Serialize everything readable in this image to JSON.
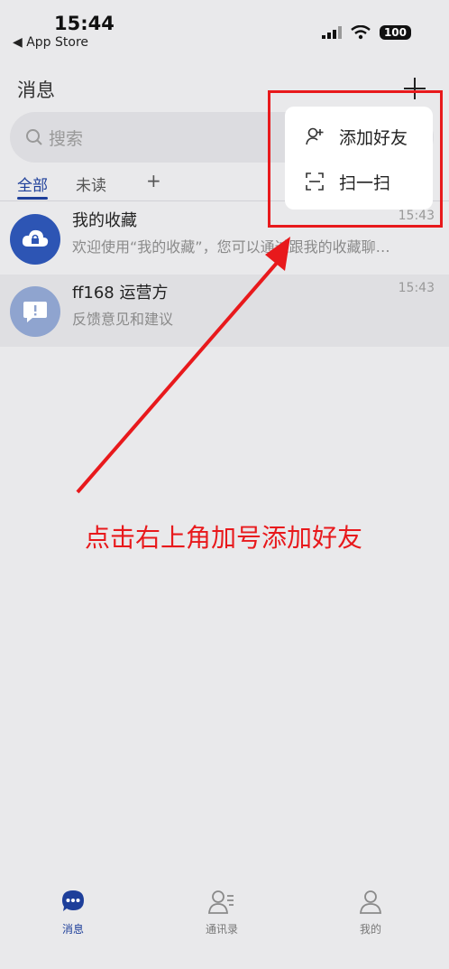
{
  "status_bar": {
    "time": "15:44",
    "back_app": "◀ App Store",
    "battery": "100"
  },
  "header": {
    "title": "消息"
  },
  "search": {
    "placeholder": "搜索"
  },
  "tabs": [
    {
      "label": "全部"
    },
    {
      "label": "未读"
    },
    {
      "label": "+"
    }
  ],
  "conversations": [
    {
      "name": "我的收藏",
      "time": "15:43",
      "preview": "欢迎使用“我的收藏”，您可以通过跟我的收藏聊…"
    },
    {
      "name": "ff168 运营方",
      "time": "15:43",
      "preview": "反馈意见和建议"
    }
  ],
  "popover_menu": [
    {
      "label": "添加好友",
      "icon": "add-user-icon"
    },
    {
      "label": "扫一扫",
      "icon": "scan-icon"
    }
  ],
  "annotation": {
    "text": "点击右上角加号添加好友",
    "color": "#e8191c"
  },
  "tabbar": [
    {
      "label": "消息",
      "icon": "chat-icon",
      "active": true
    },
    {
      "label": "通讯录",
      "icon": "contacts-icon"
    },
    {
      "label": "我的",
      "icon": "profile-icon"
    }
  ],
  "colors": {
    "accent": "#1e3f9a",
    "annotation": "#e8191c"
  }
}
